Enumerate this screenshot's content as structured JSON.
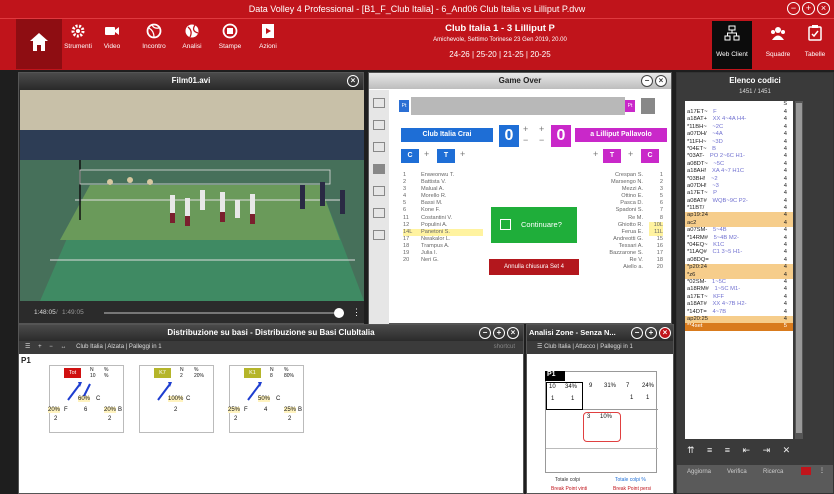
{
  "window": {
    "title": "Data Volley 4 Professional - [B1_F_Club Italia] - 6_And06 Club Italia vs Lilliput P.dvw"
  },
  "toolbar": {
    "items": [
      "Strumenti",
      "Video",
      "Incontro",
      "Analisi",
      "Stampe",
      "Azioni"
    ],
    "right_items": [
      "Web Client",
      "Squadre",
      "Tabelle"
    ]
  },
  "match": {
    "title": "Club Italia 1 - 3 Lilliput P",
    "subtitle": "Amichevole, Settimo Torinese 23 Gen 2019, 20.00",
    "sets": "24-26 | 25-20 | 21-25 | 20-25"
  },
  "video": {
    "title": "Film01.avi",
    "time_current": "1:48:05",
    "time_total": "1:49:05"
  },
  "gameover": {
    "title": "Game Over",
    "pt_label": "Pt",
    "team_home": "Club Italia Crai",
    "team_away": "a Lilliput Pallavolo",
    "score_home": "0",
    "score_away": "0",
    "c": "C",
    "t": "T",
    "continue_label": "Continuare?",
    "cancel_label": "Annulla chiusura Set 4",
    "home_roster": [
      [
        "1",
        "Enweonwu T."
      ],
      [
        "2",
        "Battista V."
      ],
      [
        "3",
        "Malual A."
      ],
      [
        "4",
        "Morello R."
      ],
      [
        "5",
        "Bassi M."
      ],
      [
        "6",
        "Kone F."
      ],
      [
        "11",
        "Costantini V."
      ],
      [
        "12",
        "Populini A."
      ],
      [
        "14L",
        "Panetoni S."
      ],
      [
        "17",
        "Nwakalor L."
      ],
      [
        "18",
        "Trampus A."
      ],
      [
        "19",
        "Julia I."
      ],
      [
        "20",
        "Neri G."
      ]
    ],
    "away_roster": [
      [
        "Crespan S.",
        "1"
      ],
      [
        "Marsengo N.",
        "2"
      ],
      [
        "Mezzi A.",
        "3"
      ],
      [
        "Ottino E.",
        "5"
      ],
      [
        "Pasca D.",
        "6"
      ],
      [
        "Spadoni S.",
        "7"
      ],
      [
        "Re M.",
        "8"
      ],
      [
        "Ghiotto R.",
        "10L"
      ],
      [
        "Ferua E.",
        "11L"
      ],
      [
        "Andreotti G.",
        "15"
      ],
      [
        "Tessari A.",
        "16"
      ],
      [
        "Bazzarone S.",
        "17"
      ],
      [
        "Re V.",
        "18"
      ],
      [
        "Aiello a.",
        "20"
      ]
    ]
  },
  "elenco": {
    "title": "Elenco codici",
    "count": "1451 / 1451",
    "col": "S",
    "rows": [
      [
        "a17ET~",
        "F",
        "4"
      ],
      [
        "a18AT+",
        "XX 4~4A H4-",
        "4"
      ],
      [
        "*11BH~",
        "~2C",
        "4"
      ],
      [
        "a07DH/",
        "~4A",
        "4"
      ],
      [
        "*11FH~",
        "~3D",
        "4"
      ],
      [
        "*04ET~",
        "B",
        "4"
      ],
      [
        "*03AT-",
        "PO 2~6C H1-",
        "4"
      ],
      [
        "a08DT~",
        "~5C",
        "4"
      ],
      [
        "a18AH!",
        "XA 4~7 H1C",
        "4"
      ],
      [
        "*03BH!",
        "~2",
        "4"
      ],
      [
        "a07DH!",
        "~3",
        "4"
      ],
      [
        "a17ET~",
        "P",
        "4"
      ],
      [
        "a08AT#",
        "WQB~9C P2-",
        "4"
      ],
      [
        "*11BT/",
        "",
        "4"
      ],
      [
        "ap19:24",
        "",
        "4"
      ],
      [
        "ac2",
        "",
        "4"
      ],
      [
        "a07SM-",
        "5~4B",
        "4"
      ],
      [
        "*14RM#",
        "5~4B M2-",
        "4"
      ],
      [
        "*04EQ~",
        "K1C",
        "4"
      ],
      [
        "*11AQ#",
        "C1 3~5 H1-",
        "4"
      ],
      [
        "a08DQ=",
        "",
        "4"
      ],
      [
        "*p20:24",
        "",
        "4"
      ],
      [
        "*z6",
        "",
        "4"
      ],
      [
        "*02SM-",
        "1~5C",
        "4"
      ],
      [
        "a18RM#",
        "1~5C M1-",
        "4"
      ],
      [
        "a17ET~",
        "KFF",
        "4"
      ],
      [
        "a18AT#",
        "XX 4~7B H2-",
        "4"
      ],
      [
        "*14DT=",
        "4~7B",
        "4"
      ],
      [
        "ap20:25",
        "",
        "4"
      ],
      [
        "**4set",
        "",
        "5"
      ]
    ],
    "footer": [
      "Aggiorna",
      "Verifica",
      "Ricerca"
    ]
  },
  "distr": {
    "title": "Distribuzione su basi - Distribuzione su Basi ClubItalia",
    "filter": "Club Italia | Alzata | Palleggi in 1",
    "shortcut": "shortcut",
    "rotation": "P1",
    "cards": [
      {
        "badge": "Tot",
        "n": "10",
        "pct": "%",
        "hdr_n": "N",
        "p_mid": "60%",
        "l_mid": "C",
        "p_left": "20%",
        "l_left": "F",
        "p_right": "20%",
        "l_right": "B",
        "n_left": "2",
        "n_mid": "6",
        "n_right": "2"
      },
      {
        "badge": "K7",
        "n": "2",
        "pct": "20%",
        "hdr_n": "N",
        "p_mid": "100%",
        "l_mid": "C",
        "p_left": "",
        "l_left": "",
        "p_right": "",
        "l_right": "",
        "n_left": "",
        "n_mid": "2",
        "n_right": ""
      },
      {
        "badge": "K1",
        "n": "8",
        "pct": "80%",
        "hdr_n": "N",
        "p_mid": "50%",
        "l_mid": "C",
        "p_left": "25%",
        "l_left": "F",
        "p_right": "25%",
        "l_right": "B",
        "n_left": "2",
        "n_mid": "4",
        "n_right": "2"
      }
    ]
  },
  "anz": {
    "title": "Analisi Zone - Senza N...",
    "filter": "Club Italia | Attacco | Palleggi in 1",
    "rotation": "P1",
    "top": [
      [
        "10",
        "34%"
      ],
      [
        "9",
        "31%"
      ],
      [
        "7",
        "24%"
      ]
    ],
    "ones": [
      "1",
      "1",
      "1",
      "1"
    ],
    "mid": [
      "3",
      "10%"
    ],
    "legend_left": "Totale colpi",
    "legend_left2": "Break Point vinti",
    "legend_right": "Totale colpi %",
    "legend_right2": "Break Point persi"
  }
}
